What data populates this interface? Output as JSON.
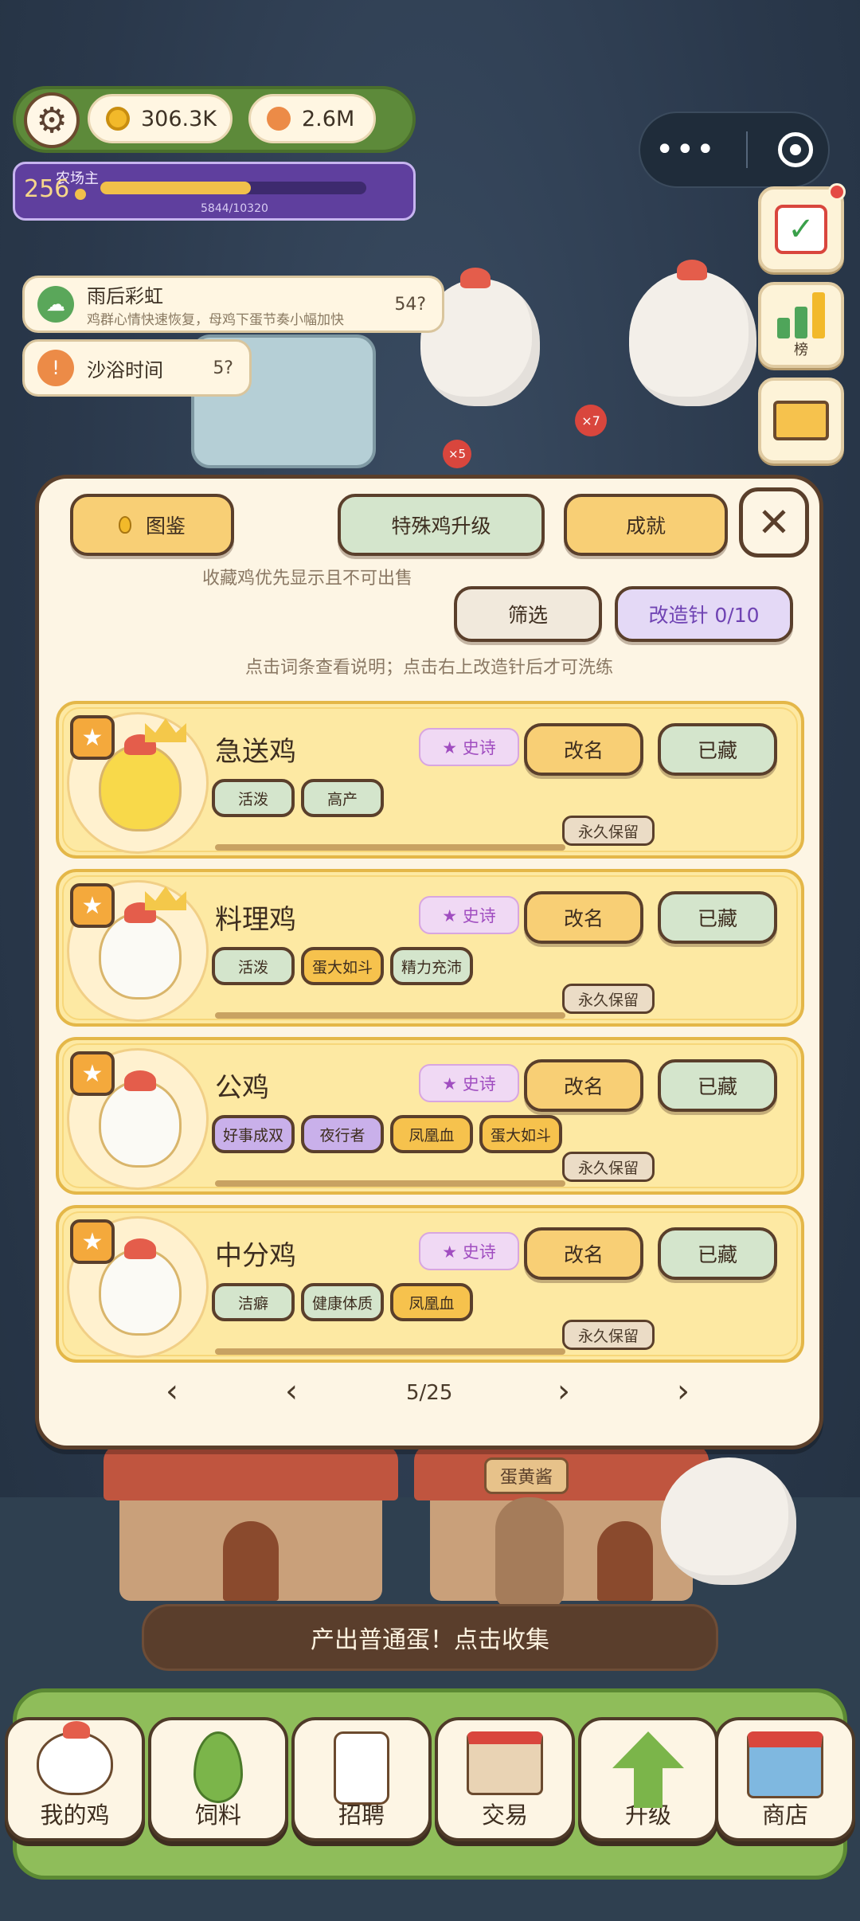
{
  "hud": {
    "coins": "306.3K",
    "eggs": "2.6M",
    "level": "256",
    "title": "农场主",
    "xp_text": "5844/10320",
    "xp_progress": 0.566
  },
  "side_buttons": {
    "ranking_label": "榜"
  },
  "buffs": [
    {
      "title": "雨后彩虹",
      "desc": "鸡群心情快速恢复，母鸡下蛋节奏小幅加快",
      "time": "54?"
    },
    {
      "title": "沙浴时间",
      "time": "5?"
    }
  ],
  "scene": {
    "egg_counts": [
      "×7",
      "×5"
    ],
    "shop_sign": "蛋黄酱"
  },
  "panel": {
    "tab_collection": "图鉴",
    "tab_special_upgrade": "特殊鸡升级",
    "tab_achievements": "成就",
    "collect_note": "收藏鸡优先显示且不可出售",
    "filter_label": "筛选",
    "reforge_label": "改造针 0/10",
    "hint": "点击词条查看说明；点击右上改造针后才可洗练",
    "cards": [
      {
        "name": "急送鸡",
        "rarity": "★ 史诗",
        "rename": "改名",
        "stored": "已藏",
        "keep": "永久保留",
        "traits": [
          {
            "label": "活泼",
            "color": "green"
          },
          {
            "label": "高产",
            "color": "green"
          }
        ]
      },
      {
        "name": "料理鸡",
        "rarity": "★ 史诗",
        "rename": "改名",
        "stored": "已藏",
        "keep": "永久保留",
        "traits": [
          {
            "label": "活泼",
            "color": "green"
          },
          {
            "label": "蛋大如斗",
            "color": "gold"
          },
          {
            "label": "精力充沛",
            "color": "green"
          }
        ]
      },
      {
        "name": "公鸡",
        "rarity": "★ 史诗",
        "rename": "改名",
        "stored": "已藏",
        "keep": "永久保留",
        "traits": [
          {
            "label": "好事成双",
            "color": "purple"
          },
          {
            "label": "夜行者",
            "color": "purple"
          },
          {
            "label": "凤凰血",
            "color": "gold"
          },
          {
            "label": "蛋大如斗",
            "color": "gold"
          }
        ]
      },
      {
        "name": "中分鸡",
        "rarity": "★ 史诗",
        "rename": "改名",
        "stored": "已藏",
        "keep": "永久保留",
        "traits": [
          {
            "label": "洁癖",
            "color": "green"
          },
          {
            "label": "健康体质",
            "color": "green"
          },
          {
            "label": "凤凰血",
            "color": "gold"
          }
        ]
      }
    ],
    "pager": {
      "first": "‹",
      "prev": "‹",
      "page": "5/25",
      "next": "›",
      "last": "›"
    }
  },
  "toast": "产出普通蛋！点击收集",
  "nav": [
    {
      "label": "我的鸡",
      "icon": "chicken-icon"
    },
    {
      "label": "饲料",
      "icon": "leaf-icon"
    },
    {
      "label": "招聘",
      "icon": "id-badge-icon"
    },
    {
      "label": "交易",
      "icon": "market-icon"
    },
    {
      "label": "升级",
      "icon": "up-arrow-icon"
    },
    {
      "label": "商店",
      "icon": "shop-icon"
    }
  ],
  "colors": {
    "panel_bg": "#fdf5e4",
    "card_bg": "#fde9a3",
    "border_brown": "#5a3f2b",
    "accent_yellow": "#f8cf75",
    "accent_green": "#d4e5cc",
    "accent_purple": "#e4d9f6"
  }
}
